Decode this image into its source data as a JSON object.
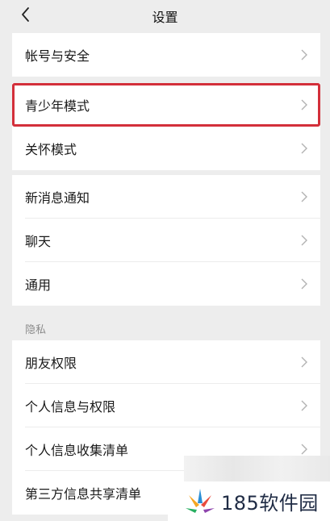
{
  "header": {
    "title": "设置"
  },
  "groups": [
    {
      "items": [
        {
          "label": "帐号与安全"
        }
      ]
    },
    {
      "items": [
        {
          "label": "青少年模式",
          "highlighted": true
        },
        {
          "label": "关怀模式"
        }
      ]
    },
    {
      "items": [
        {
          "label": "新消息通知"
        },
        {
          "label": "聊天"
        },
        {
          "label": "通用"
        }
      ]
    },
    {
      "section_label": "隐私",
      "items": [
        {
          "label": "朋友权限"
        },
        {
          "label": "个人信息与权限"
        },
        {
          "label": "个人信息收集清单"
        },
        {
          "label": "第三方信息共享清单"
        }
      ]
    }
  ],
  "watermark": {
    "text": "185软件园"
  },
  "colors": {
    "background": "#ededed",
    "highlight": "#d32f3a"
  }
}
